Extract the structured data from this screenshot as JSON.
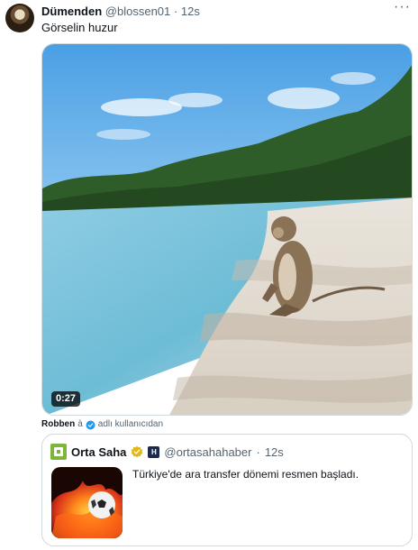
{
  "post": {
    "display_name": "Dümenden",
    "handle": "@blossen01",
    "separator": "·",
    "time": "12s",
    "more_icon": "more-horizontal-icon",
    "text": "Görselin huzur"
  },
  "media": {
    "icon": "video-player",
    "duration": "0:27"
  },
  "attribution": {
    "from_user": "Robben",
    "suffix": "à",
    "label": "adlı kullanıcıdan"
  },
  "quote": {
    "display_name": "Orta Saha",
    "affiliate_badge": "H",
    "handle": "@ortasahahaber",
    "separator": "·",
    "time": "12s",
    "text": "Türkiye'de ara transfer dönemi resmen başladı.",
    "thumbnail_icon": "flaming-soccer-ball"
  },
  "colors": {
    "primary_text": "#0f1419",
    "secondary_text": "#536471",
    "border": "#cfd9de",
    "verified_blue": "#1d9bf0",
    "verified_gold": "#e2b719"
  }
}
